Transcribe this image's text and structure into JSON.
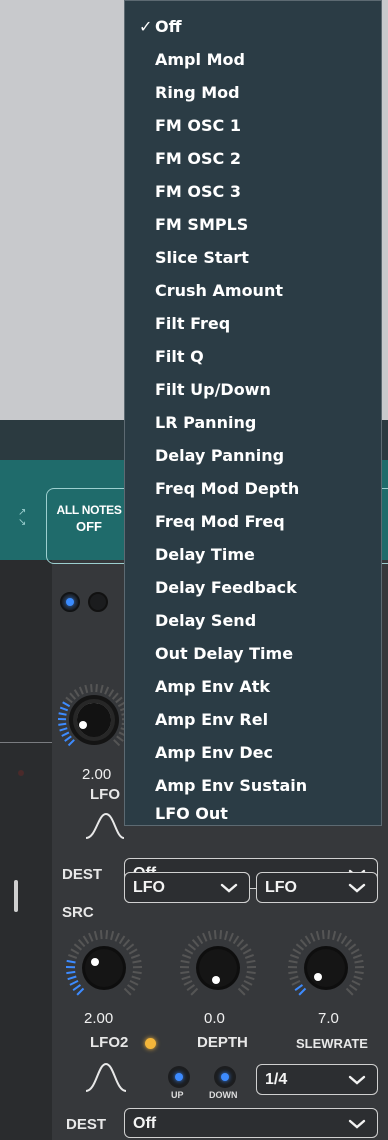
{
  "menu": {
    "items": [
      {
        "label": "Off",
        "checkmark": "✓"
      },
      {
        "label": "Ampl Mod"
      },
      {
        "label": "Ring Mod"
      },
      {
        "label": "FM OSC 1"
      },
      {
        "label": "FM OSC 2"
      },
      {
        "label": "FM OSC 3"
      },
      {
        "label": "FM SMPLS"
      },
      {
        "label": "Slice Start"
      },
      {
        "label": "Crush Amount"
      },
      {
        "label": "Filt Freq"
      },
      {
        "label": "Filt Q"
      },
      {
        "label": "Filt Up/Down"
      },
      {
        "label": "LR Panning"
      },
      {
        "label": "Delay Panning"
      },
      {
        "label": "Freq Mod Depth"
      },
      {
        "label": "Freq Mod Freq"
      },
      {
        "label": "Delay Time"
      },
      {
        "label": "Delay Feedback"
      },
      {
        "label": "Delay Send"
      },
      {
        "label": "Out Delay Time"
      },
      {
        "label": "Amp Env Atk"
      },
      {
        "label": "Amp Env Rel"
      },
      {
        "label": "Amp Env Dec"
      },
      {
        "label": "Amp Env Sustain"
      },
      {
        "label": "LFO Out"
      }
    ]
  },
  "all_notes": {
    "line1": "ALL NOTES",
    "line2": "OFF"
  },
  "lfo1": {
    "value": "2.00",
    "label": "LFO"
  },
  "dest1": {
    "label": "DEST",
    "value": "Off"
  },
  "src": {
    "label": "SRC",
    "value1": "LFO",
    "value2": "LFO"
  },
  "lfo2": {
    "rate_value": "2.00",
    "rate_label": "LFO2",
    "depth_value": "0.0",
    "depth_label": "DEPTH",
    "slew_value": "7.0",
    "slew_label": "SLEWRATE",
    "up_label": "UP",
    "down_label": "DOWN",
    "division": "1/4",
    "led_color": "#f4b63a"
  },
  "dest2": {
    "label": "DEST",
    "value": "Off"
  },
  "colors": {
    "accent": "#3d8bff",
    "menu_bg": "#2b3c45",
    "teal": "#1f6b6b"
  }
}
